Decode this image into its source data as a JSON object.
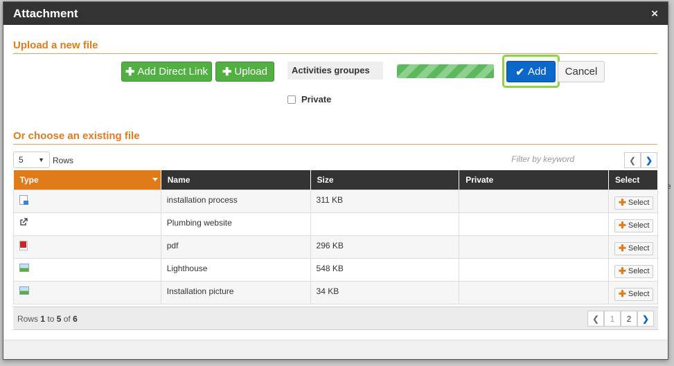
{
  "dialog": {
    "title": "Attachment",
    "close_label": "×"
  },
  "upload": {
    "section_title": "Upload a new file",
    "add_direct_link_label": "Add Direct Link",
    "upload_label": "Upload",
    "file_name": "Activities groupes",
    "progress_fraction": 1.0,
    "add_label": "Add",
    "cancel_label": "Cancel",
    "private_label": "Private"
  },
  "existing": {
    "section_title": "Or choose an existing file",
    "rows_value": "5",
    "rows_label": "Rows",
    "filter_placeholder": "Filter by keyword",
    "columns": [
      "Type",
      "Name",
      "Size",
      "Private",
      "Select"
    ],
    "rows": [
      {
        "type_icon": "document-icon",
        "name": "installation process",
        "size": "311 KB",
        "private": "",
        "select_label": "Select"
      },
      {
        "type_icon": "external-link-icon",
        "name": "Plumbing website",
        "size": "",
        "private": "",
        "select_label": "Select"
      },
      {
        "type_icon": "pdf-icon",
        "name": "pdf",
        "size": "296 KB",
        "private": "",
        "select_label": "Select"
      },
      {
        "type_icon": "image-icon",
        "name": "Lighthouse",
        "size": "548 KB",
        "private": "",
        "select_label": "Select"
      },
      {
        "type_icon": "image-icon",
        "name": "Installation picture",
        "size": "34 KB",
        "private": "",
        "select_label": "Select"
      }
    ],
    "footer": {
      "prefix": "Rows ",
      "from": "1",
      "to_word": " to ",
      "to": "5",
      "of_word": " of ",
      "total": "6"
    },
    "pages": [
      "1",
      "2"
    ]
  },
  "background": {
    "partial_text": "e"
  },
  "colors": {
    "accent_orange": "#e07b1a",
    "primary_blue": "#0b67c9",
    "green": "#52b043",
    "highlight": "#8fd14a"
  }
}
